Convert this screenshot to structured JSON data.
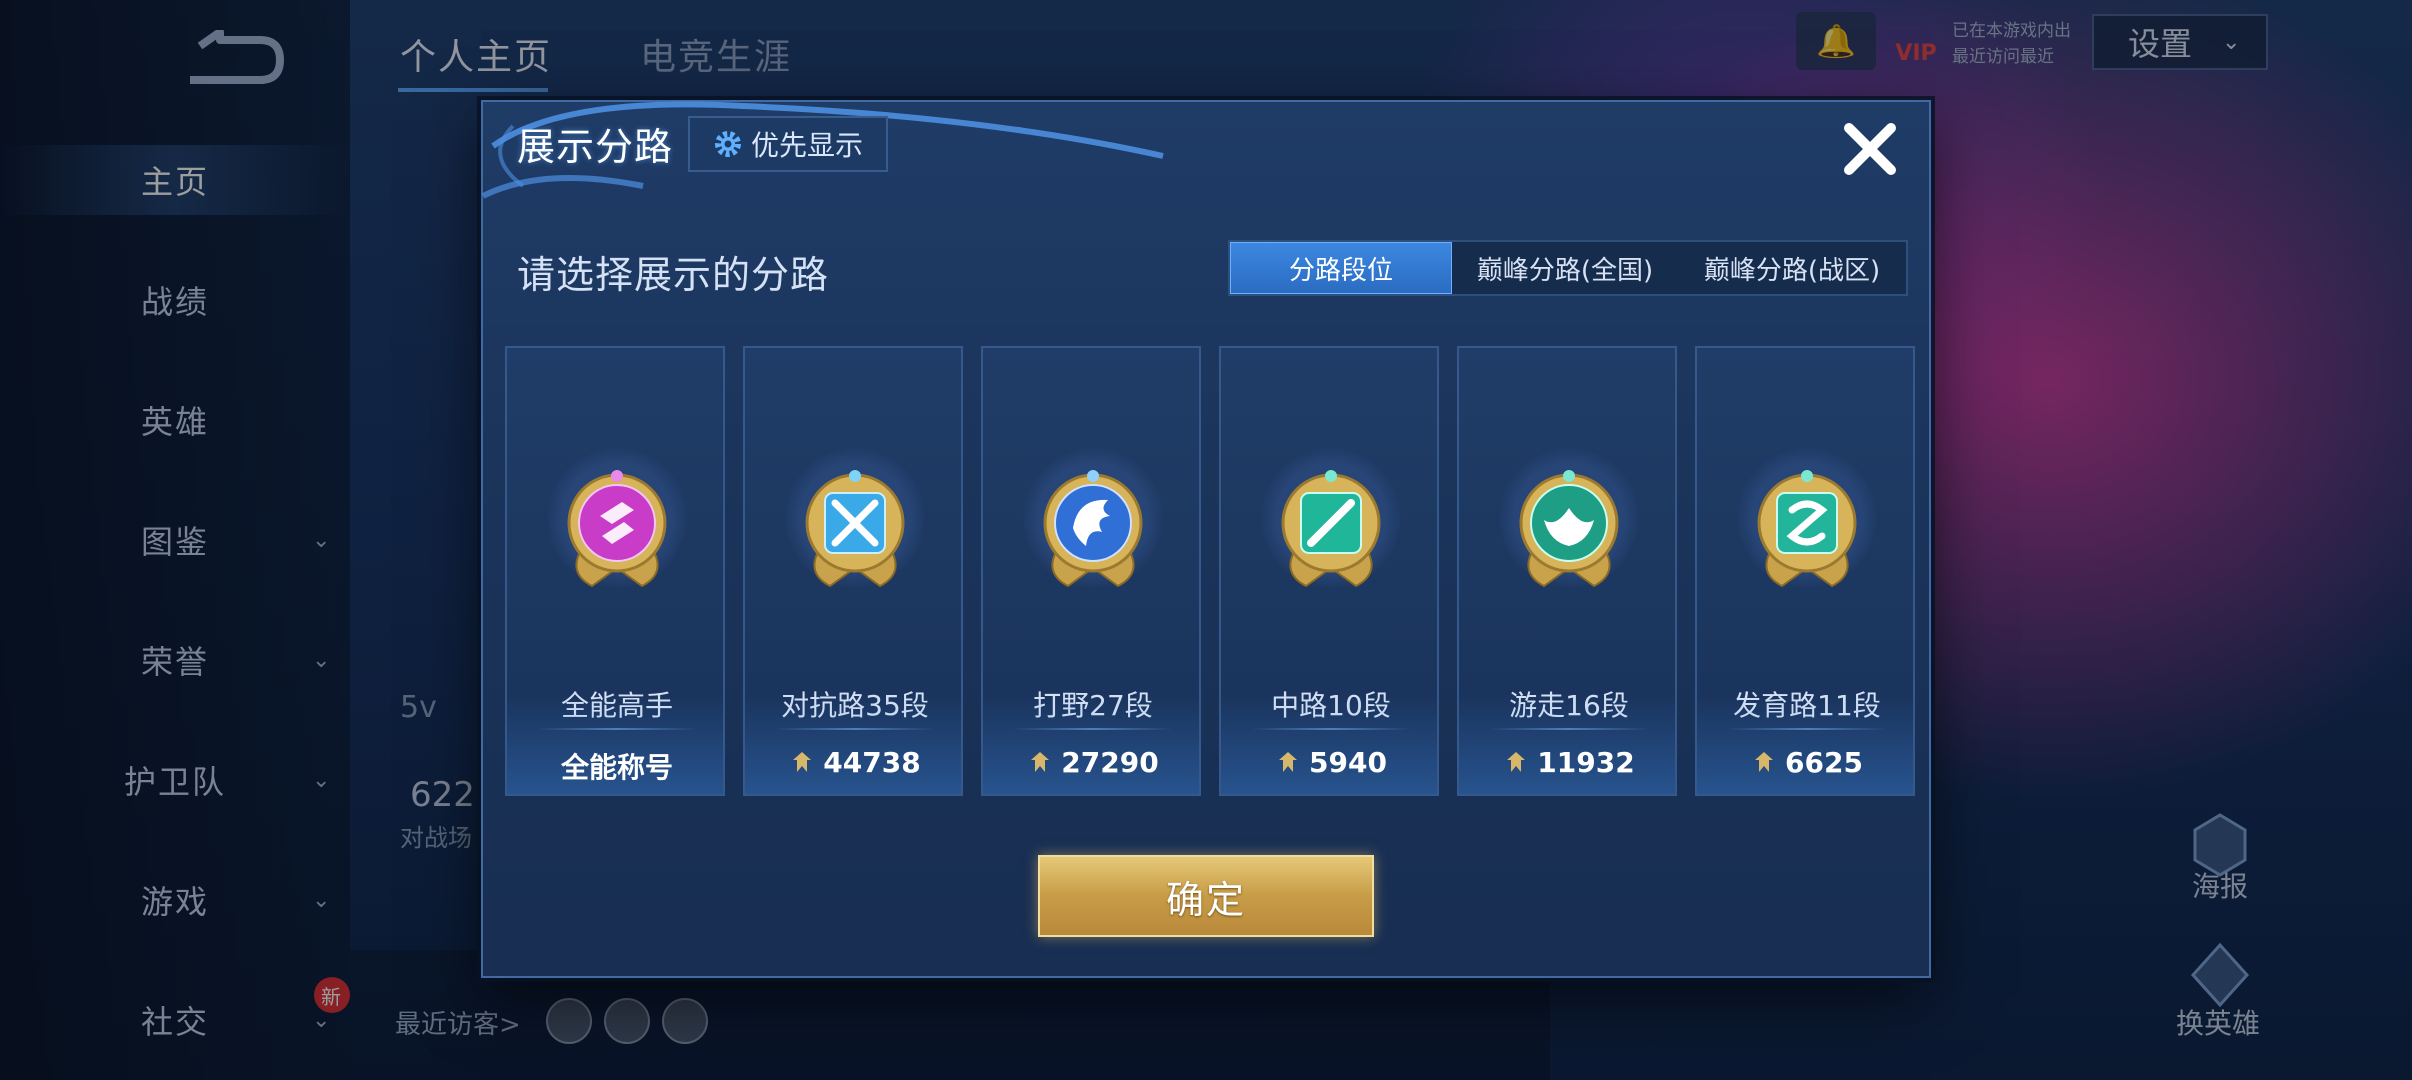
{
  "background": {
    "top_tabs": [
      "个人主页",
      "电竞生涯"
    ],
    "sidebar": [
      {
        "label": "主页",
        "active": true,
        "chevron": false
      },
      {
        "label": "战绩",
        "active": false,
        "chevron": false
      },
      {
        "label": "英雄",
        "active": false,
        "chevron": false
      },
      {
        "label": "图鉴",
        "active": false,
        "chevron": true
      },
      {
        "label": "荣誉",
        "active": false,
        "chevron": true
      },
      {
        "label": "护卫队",
        "active": false,
        "chevron": true
      },
      {
        "label": "游戏",
        "active": false,
        "chevron": true
      },
      {
        "label": "社交",
        "active": false,
        "chevron": true,
        "badge": "新"
      }
    ],
    "settings_label": "设置",
    "vip_label": "VIP",
    "status_lines": [
      "已在本游戏内出",
      "最近访问最近"
    ],
    "profile_partial": {
      "mode": "5v",
      "number": "622",
      "caption": "对战场"
    },
    "recent_visitors_label": "最近访客>",
    "right_actions": [
      "海报",
      "换英雄"
    ]
  },
  "modal": {
    "title": "展示分路",
    "priority_button": "优先显示",
    "prompt": "请选择展示的分路",
    "tabs": [
      {
        "label": "分路段位",
        "active": true
      },
      {
        "label": "巅峰分路(全国)",
        "active": false
      },
      {
        "label": "巅峰分路(战区)",
        "active": false
      }
    ],
    "cards": [
      {
        "label": "全能高手",
        "value": "全能称号",
        "icon": "allround-emblem-icon",
        "color": "#c83cc8",
        "points": false
      },
      {
        "label": "对抗路35段",
        "value": "44738",
        "icon": "clash-lane-emblem-icon",
        "color": "#3aa9e8",
        "points": true
      },
      {
        "label": "打野27段",
        "value": "27290",
        "icon": "jungle-emblem-icon",
        "color": "#2f6fd6",
        "points": true
      },
      {
        "label": "中路10段",
        "value": "5940",
        "icon": "mid-lane-emblem-icon",
        "color": "#1fb69a",
        "points": true
      },
      {
        "label": "游走16段",
        "value": "11932",
        "icon": "roam-emblem-icon",
        "color": "#1f9e86",
        "points": true
      },
      {
        "label": "发育路11段",
        "value": "6625",
        "icon": "farm-lane-emblem-icon",
        "color": "#22b59c",
        "points": true
      }
    ],
    "confirm_button": "确定"
  }
}
